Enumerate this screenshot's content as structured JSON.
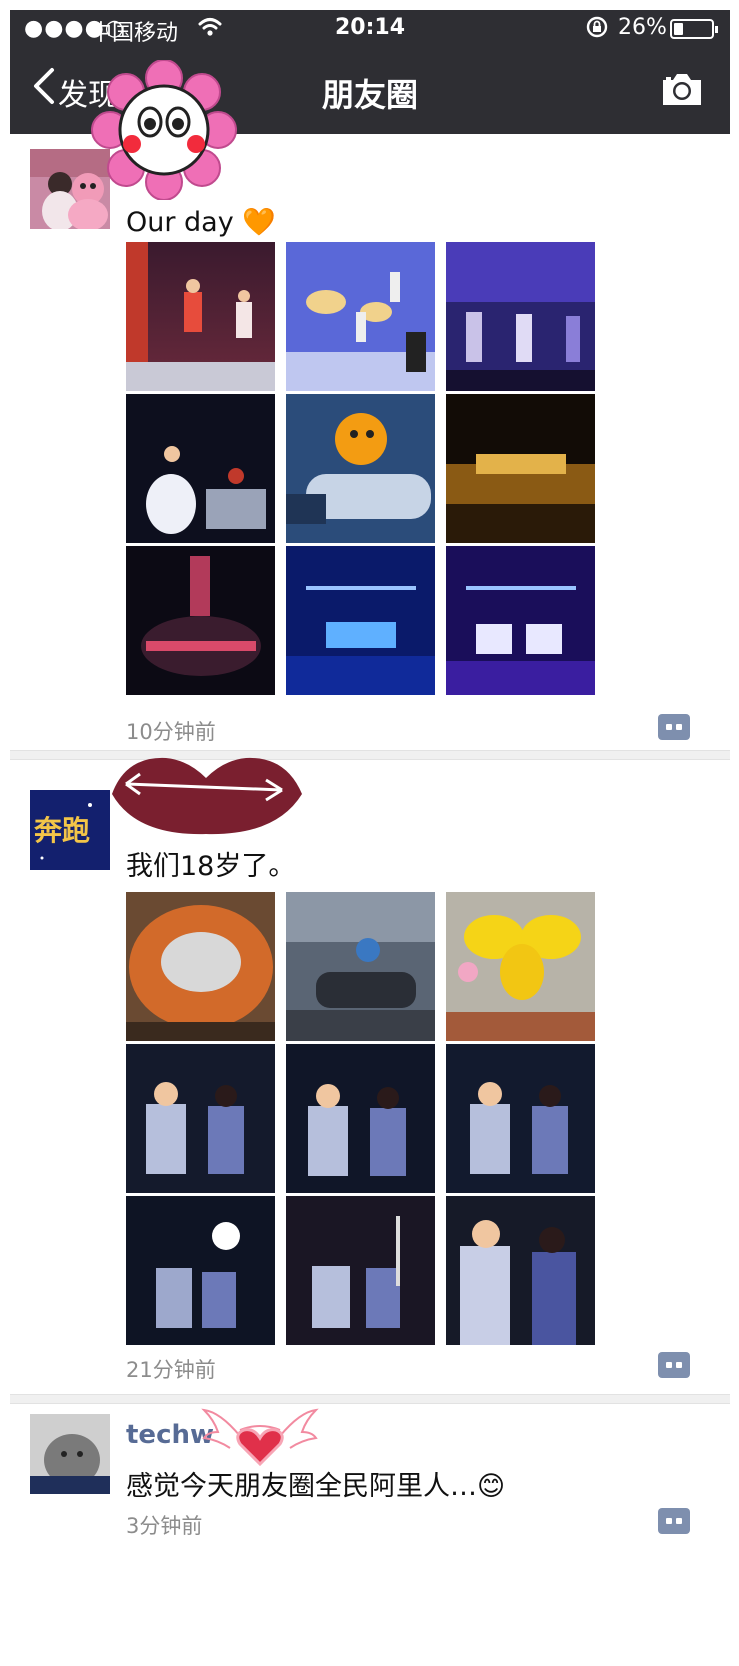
{
  "status_bar": {
    "signal": "●●●●○",
    "carrier": "中国移动",
    "time": "20:14",
    "battery_percent": "26%",
    "battery_level": 0.26
  },
  "nav": {
    "back_label": "发现",
    "title": "朋友圈",
    "camera_icon": "camera-icon"
  },
  "posts": [
    {
      "name": "",
      "text": "Our day 🧡",
      "time": "10分钟前",
      "photos": [
        "stage-singers",
        "stage-dancers-fans",
        "stage-band",
        "stage-singer-white-dress",
        "mascot-rocket",
        "gold-stage",
        "arena-red",
        "annual-party-one",
        "annual-party-women"
      ]
    },
    {
      "name": "",
      "text": "我们18岁了。",
      "time": "21分钟前",
      "photos": [
        "stadium-aerial",
        "mascot-cannon",
        "yellow-costume",
        "duet-singers-1",
        "duet-singers-2",
        "duet-singers-3",
        "duet-singers-4",
        "duet-singers-5",
        "duet-singers-6"
      ]
    },
    {
      "name": "techw",
      "text": "感觉今天朋友圈全民阿里人…😊",
      "time": "3分钟前",
      "photos": []
    }
  ],
  "colors": {
    "navbar": "#2e2e33",
    "name_link": "#576b95",
    "time_text": "#8c8c8c",
    "comment_button": "#7e8fae",
    "separator": "#f0f0f0"
  }
}
